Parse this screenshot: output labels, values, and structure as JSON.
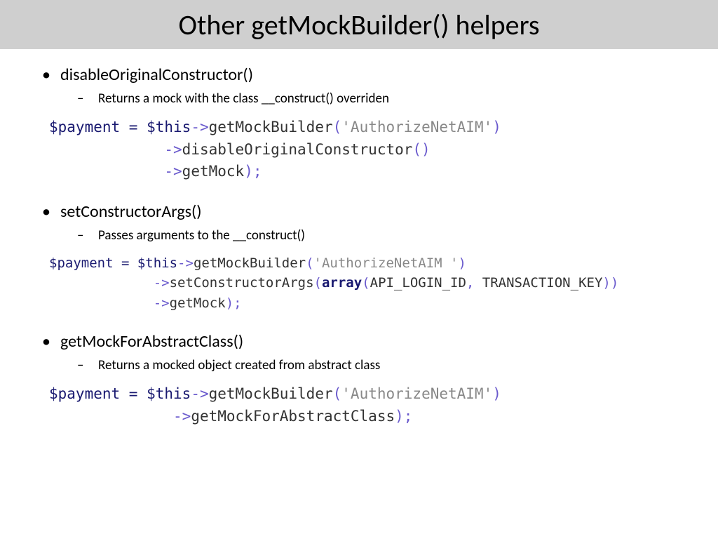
{
  "title": "Other getMockBuilder() helpers",
  "sections": [
    {
      "bullet": "disableOriginalConstructor()",
      "sub": "Returns a mock with the class __construct() overriden"
    },
    {
      "bullet": "setConstructorArgs()",
      "sub": "Passes arguments to the __construct()"
    },
    {
      "bullet": "getMockForAbstractClass()",
      "sub": "Returns a mocked object created from abstract class"
    }
  ],
  "code": {
    "payment": "$payment",
    "eq": " = ",
    "this": "$this",
    "arrow": "->",
    "getMockBuilder": "getMockBuilder",
    "disableOriginalConstructor": "disableOriginalConstructor",
    "setConstructorArgs": "setConstructorArgs",
    "getMock": "getMock",
    "getMockForAbstractClass": "getMockForAbstractClass",
    "str_AuthorizeNetAIM": "'AuthorizeNetAIM'",
    "str_AuthorizeNetAIM_sp": "'AuthorizeNetAIM '",
    "array": "array",
    "API_LOGIN_ID": "API_LOGIN_ID",
    "TRANSACTION_KEY": "TRANSACTION_KEY",
    "comma_sp": ", ",
    "lp": "(",
    "rp": ")",
    "rp_semi": ");",
    "rp_rp": "))",
    "empty_parens": "()",
    "indent1": "             ",
    "indent2": "              "
  }
}
